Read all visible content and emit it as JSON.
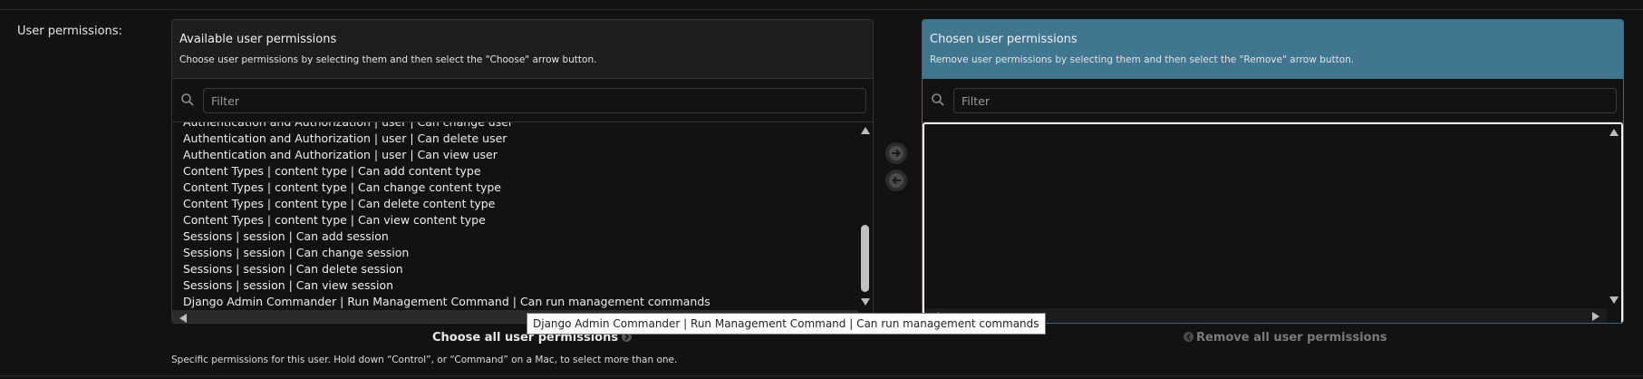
{
  "field": {
    "label": "User permissions:"
  },
  "available": {
    "title": "Available user permissions",
    "help": "Choose user permissions by selecting them and then select the \"Choose\" arrow button.",
    "filter_placeholder": "Filter",
    "options": [
      "Authentication and Authorization | user | Can change user",
      "Authentication and Authorization | user | Can delete user",
      "Authentication and Authorization | user | Can view user",
      "Content Types | content type | Can add content type",
      "Content Types | content type | Can change content type",
      "Content Types | content type | Can delete content type",
      "Content Types | content type | Can view content type",
      "Sessions | session | Can add session",
      "Sessions | session | Can change session",
      "Sessions | session | Can delete session",
      "Sessions | session | Can view session",
      "Django Admin Commander | Run Management Command | Can run management commands"
    ],
    "choose_all_label": "Choose all user permissions"
  },
  "chosen": {
    "title": "Chosen user permissions",
    "help": "Remove user permissions by selecting them and then select the \"Remove\" arrow button.",
    "filter_placeholder": "Filter",
    "options": [],
    "remove_all_label": "Remove all user permissions"
  },
  "help_text": "Specific permissions for this user. Hold down “Control”, or “Command” on a Mac, to select more than one.",
  "tooltip": "Django Admin Commander | Run Management Command | Can run management commands",
  "icons": {
    "search": "search-icon",
    "choose": "arrow-right-circle-icon",
    "remove": "arrow-left-circle-icon"
  },
  "colors": {
    "chosen_header": "#417690",
    "background": "#121212"
  }
}
